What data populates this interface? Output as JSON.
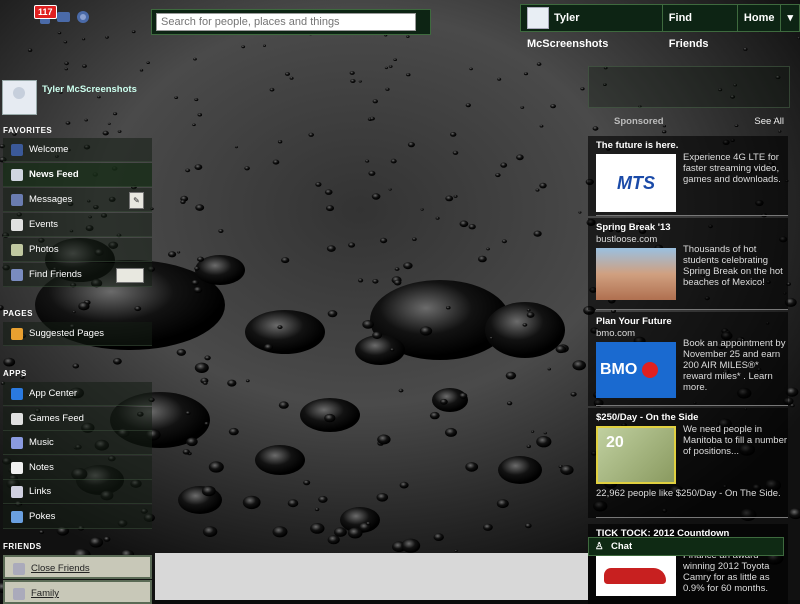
{
  "topbar": {
    "notifications_count": "117",
    "search_placeholder": "Search for people, places and things",
    "user_name": "Tyler McScreenshots",
    "find_friends": "Find Friends",
    "home": "Home",
    "menu_icon": "chevron-down-icon"
  },
  "profile": {
    "name": "Tyler McScreenshots"
  },
  "sections": {
    "favorites": "FAVORITES",
    "pages": "PAGES",
    "apps": "APPS",
    "friends": "FRIENDS"
  },
  "favorites": [
    {
      "label": "Welcome",
      "icon": "facebook-icon",
      "color": "#3b5998"
    },
    {
      "label": "News Feed",
      "icon": "news-feed-icon",
      "color": "#d0d6e0"
    },
    {
      "label": "Messages",
      "icon": "messages-icon",
      "color": "#6a7cb0"
    },
    {
      "label": "Events",
      "icon": "calendar-icon",
      "color": "#e0e0e0"
    },
    {
      "label": "Photos",
      "icon": "photos-icon",
      "color": "#c0c8a0"
    },
    {
      "label": "Find Friends",
      "icon": "find-friends-icon",
      "color": "#7a8cc0"
    }
  ],
  "pages": [
    {
      "label": "Suggested Pages",
      "icon": "pages-icon",
      "color": "#e8a030"
    }
  ],
  "apps": [
    {
      "label": "App Center",
      "icon": "app-center-icon",
      "color": "#2a7ae0"
    },
    {
      "label": "Games Feed",
      "icon": "games-icon",
      "color": "#e0e0e0"
    },
    {
      "label": "Music",
      "icon": "music-icon",
      "color": "#8a9ae0"
    },
    {
      "label": "Notes",
      "icon": "notes-icon",
      "color": "#f0f0f0"
    },
    {
      "label": "Links",
      "icon": "links-icon",
      "color": "#d0d0e0"
    },
    {
      "label": "Pokes",
      "icon": "pokes-icon",
      "color": "#6aa0e0"
    }
  ],
  "friends": [
    {
      "label": "Close Friends",
      "icon": "close-friends-icon"
    },
    {
      "label": "Family",
      "icon": "family-icon"
    }
  ],
  "sponsored": {
    "label": "Sponsored",
    "see_all": "See All"
  },
  "ads": [
    {
      "title": "The future is here.",
      "subtitle": "",
      "body": "Experience 4G LTE for faster streaming video, games and downloads.",
      "image": "MTS"
    },
    {
      "title": "Spring Break '13",
      "subtitle": "bustloose.com",
      "body": "Thousands of hot students celebrating Spring Break on the hot beaches of Mexico!",
      "image": "spring-break-photo"
    },
    {
      "title": "Plan Your Future",
      "subtitle": "bmo.com",
      "body": "Book an appointment by November 25 and earn 200 AIR MILES®* reward miles* . Learn more.",
      "image": "BMO"
    },
    {
      "title": "$250/Day - On the Side",
      "subtitle": "",
      "body": "We need people in Manitoba to fill a number of positions...",
      "likes": "22,962 people like $250/Day - On The Side.",
      "image": "20"
    },
    {
      "title": "TICK TOCK: 2012 Countdown",
      "subtitle": "",
      "body": "Finance an award-winning 2012 Toyota Camry for as little as 0.9% for 60 months.",
      "image": "car-photo"
    }
  ],
  "chat": {
    "label": "Chat"
  }
}
